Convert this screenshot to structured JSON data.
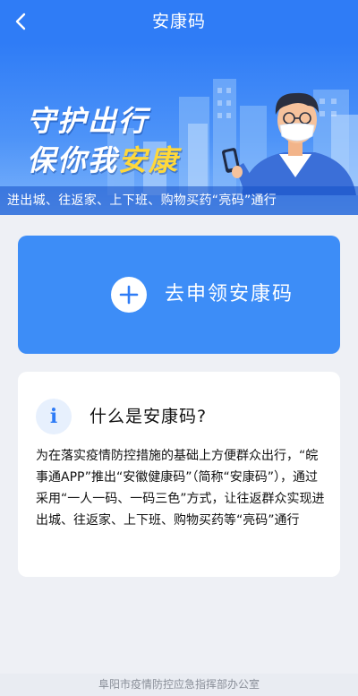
{
  "nav": {
    "title": "安康码",
    "back_icon": "chevron-left-icon"
  },
  "banner": {
    "slogan_line1": "守护出行",
    "slogan_line2_prefix": "保你我",
    "slogan_line2_highlight": "安康",
    "strip_text": "进出城、往返家、上下班、购物买药“亮码”通行",
    "highlight_color": "#ffd83a"
  },
  "apply": {
    "label": "去申领安康码",
    "icon": "plus-icon",
    "bg_color": "#3d8df7"
  },
  "info": {
    "icon": "info-icon",
    "icon_glyph": "i",
    "title": "什么是安康码?",
    "body": "为在落实疫情防控措施的基础上方便群众出行，“皖事通APP”推出“安徽健康码”（简称“安康码”），通过采用“一人一码、一码三色”方式，让往返群众实现进出城、往返家、上下班、购物买药等“亮码”通行"
  },
  "footer": {
    "text": "阜阳市疫情防控应急指挥部办公室"
  },
  "colors": {
    "primary": "#2f7cf6",
    "page_bg": "#eef0f5"
  }
}
